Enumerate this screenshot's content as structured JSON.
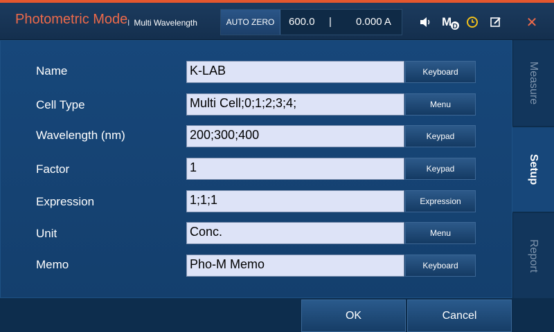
{
  "header": {
    "title": "Photometric Mode",
    "subtitle_separator": "I",
    "subtitle": "Multi Wavelength",
    "autozero_label": "AUTO ZERO",
    "wavelength_readout": "600.0",
    "readout_separator": "|",
    "absorbance_readout": "0.000 A",
    "mode_badge": "M",
    "mode_badge_sub": "D",
    "close_glyph": "✕",
    "icons": [
      "speaker-icon",
      "method-icon",
      "clock-icon",
      "edit-icon",
      "close-icon"
    ],
    "accent_color": "#ee6a4a",
    "clock_color": "#f3c21b"
  },
  "form": {
    "rows": [
      {
        "label": "Name",
        "value": "K-LAB",
        "button": "Keyboard"
      },
      {
        "label": "Cell Type",
        "value": "Multi Cell;0;1;2;3;4;",
        "button": "Menu"
      },
      {
        "label": "Wavelength (nm)",
        "value": "200;300;400",
        "button": "Keypad"
      },
      {
        "label": "Factor",
        "value": "1",
        "button": "Keypad"
      },
      {
        "label": "Expression",
        "value": "1;1;1",
        "button": "Expression"
      },
      {
        "label": "Unit",
        "value": "Conc.",
        "button": "Menu"
      },
      {
        "label": "Memo",
        "value": "Pho-M Memo",
        "button": "Keyboard"
      }
    ]
  },
  "tabs": {
    "measure": "Measure",
    "setup": "Setup",
    "report": "Report",
    "active": "Setup"
  },
  "footer": {
    "ok_label": "OK",
    "cancel_label": "Cancel"
  }
}
